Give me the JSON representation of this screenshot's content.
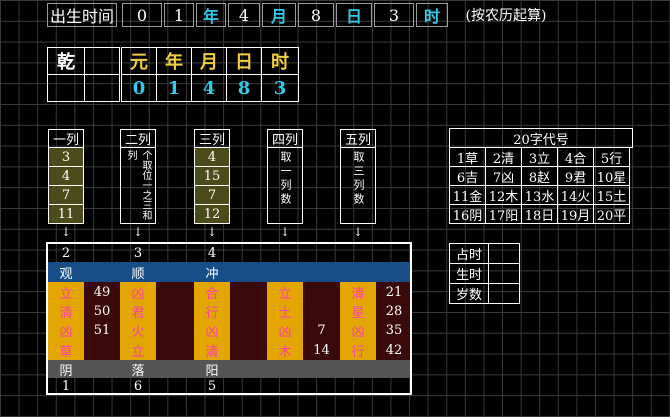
{
  "header": {
    "label": "出生时间",
    "values": [
      "0",
      "1",
      "年",
      "4",
      "月",
      "8",
      "日",
      "3",
      "时"
    ],
    "note": "(按农历起算)"
  },
  "bagua": {
    "name": "乾",
    "labels": [
      "元",
      "年",
      "月",
      "日",
      "时"
    ],
    "values": [
      "0",
      "1",
      "4",
      "8",
      "3"
    ]
  },
  "columns": {
    "col1": {
      "title": "一列",
      "items": [
        "3",
        "4",
        "7",
        "11"
      ]
    },
    "col2": {
      "title": "二列",
      "text": "个取位一之三和列"
    },
    "col3": {
      "title": "三列",
      "items": [
        "4",
        "15",
        "7",
        "12"
      ]
    },
    "col4": {
      "title": "四列",
      "text": "取一列数"
    },
    "col5": {
      "title": "五列",
      "text": "取三列数"
    }
  },
  "codes": {
    "title": "20字代号",
    "items": [
      "1草",
      "2清",
      "3立",
      "4合",
      "5行",
      "6吉",
      "7凶",
      "8赵",
      "9君",
      "10星",
      "11金",
      "12木",
      "13水",
      "14火",
      "15土",
      "16阴",
      "17阳",
      "18日",
      "19月",
      "20平"
    ]
  },
  "result": {
    "top": [
      "2",
      "3",
      "4"
    ],
    "row_guan": [
      "观",
      "顺",
      "冲"
    ],
    "rows": [
      [
        "立",
        "49",
        "凶",
        "合",
        "立",
        "清",
        "21"
      ],
      [
        "清",
        "50",
        "君",
        "行",
        "土",
        "星",
        "28"
      ],
      [
        "凶",
        "51",
        "火",
        "凶",
        "凶",
        "7",
        "凶",
        "35"
      ],
      [
        "草",
        "立",
        "清",
        "木",
        "14",
        "行",
        "42"
      ]
    ],
    "r1": {
      "a": "立",
      "b": "49",
      "c": "凶",
      "d": "合",
      "e": "立",
      "f": "",
      "g": "清",
      "h": "21"
    },
    "r2": {
      "a": "清",
      "b": "50",
      "c": "君",
      "d": "行",
      "e": "土",
      "f": "",
      "g": "星",
      "h": "28"
    },
    "r3": {
      "a": "凶",
      "b": "51",
      "c": "火",
      "d": "凶",
      "e": "凶",
      "f": "7",
      "g": "凶",
      "h": "35"
    },
    "r4": {
      "a": "草",
      "b": "",
      "c": "立",
      "d": "清",
      "e": "木",
      "f": "14",
      "g": "行",
      "h": "42"
    },
    "yin": [
      "阴",
      "落",
      "阳"
    ],
    "bottom": [
      "1",
      "6",
      "5"
    ]
  },
  "side": {
    "labels": [
      "占时",
      "生时",
      "岁数"
    ]
  },
  "arrow": "↓"
}
